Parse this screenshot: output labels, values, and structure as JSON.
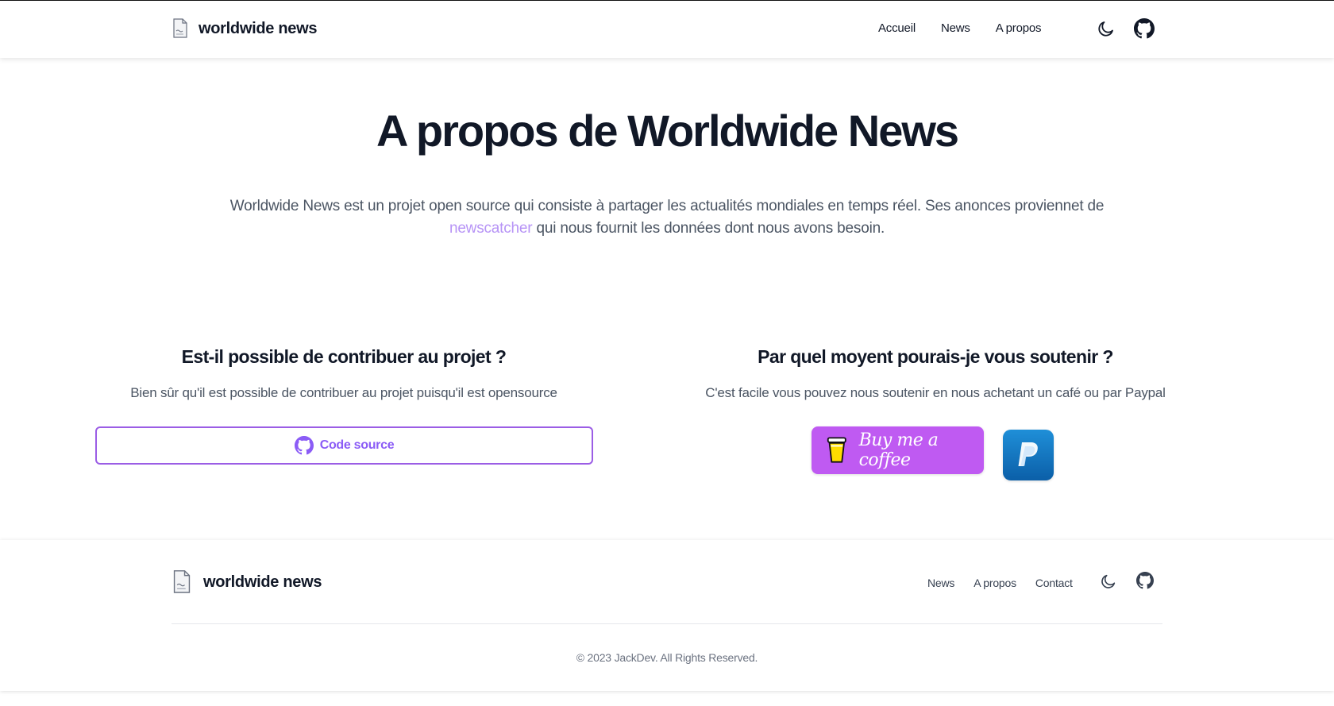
{
  "brand": {
    "name": "worldwide news"
  },
  "nav": {
    "items": [
      {
        "label": "Accueil"
      },
      {
        "label": "News"
      },
      {
        "label": "A propos"
      }
    ]
  },
  "hero": {
    "title": "A propos de Worldwide News",
    "desc_before": "Worldwide News est un projet open source qui consiste à partager les actualités mondiales en temps réel. Ses anonces proviennet de ",
    "desc_link": "newscatcher",
    "desc_after": " qui nous fournit les données dont nous avons besoin."
  },
  "contribute": {
    "heading": "Est-il possible de contribuer au projet ?",
    "text": "Bien sûr qu'il est possible de contribuer au projet puisqu'il est opensource",
    "button_label": "Code source"
  },
  "support": {
    "heading": "Par quel moyent pourais-je vous soutenir ?",
    "text": "C'est facile vous pouvez nous soutenir en nous achetant un café ou par Paypal",
    "coffee_label": "Buy me a coffee"
  },
  "footer": {
    "brand": "worldwide news",
    "links": [
      {
        "label": "News"
      },
      {
        "label": "A propos"
      },
      {
        "label": "Contact"
      }
    ],
    "copyright": "© 2023 JackDev. All Rights Reserved."
  },
  "colors": {
    "accent": "#8b5cf6",
    "link": "#b794f6",
    "coffee": "#bf5af2",
    "paypal": "#1a7fc9"
  },
  "icons": [
    "document-logo-icon",
    "moon-icon",
    "github-icon",
    "coffee-cup-icon",
    "paypal-icon"
  ]
}
